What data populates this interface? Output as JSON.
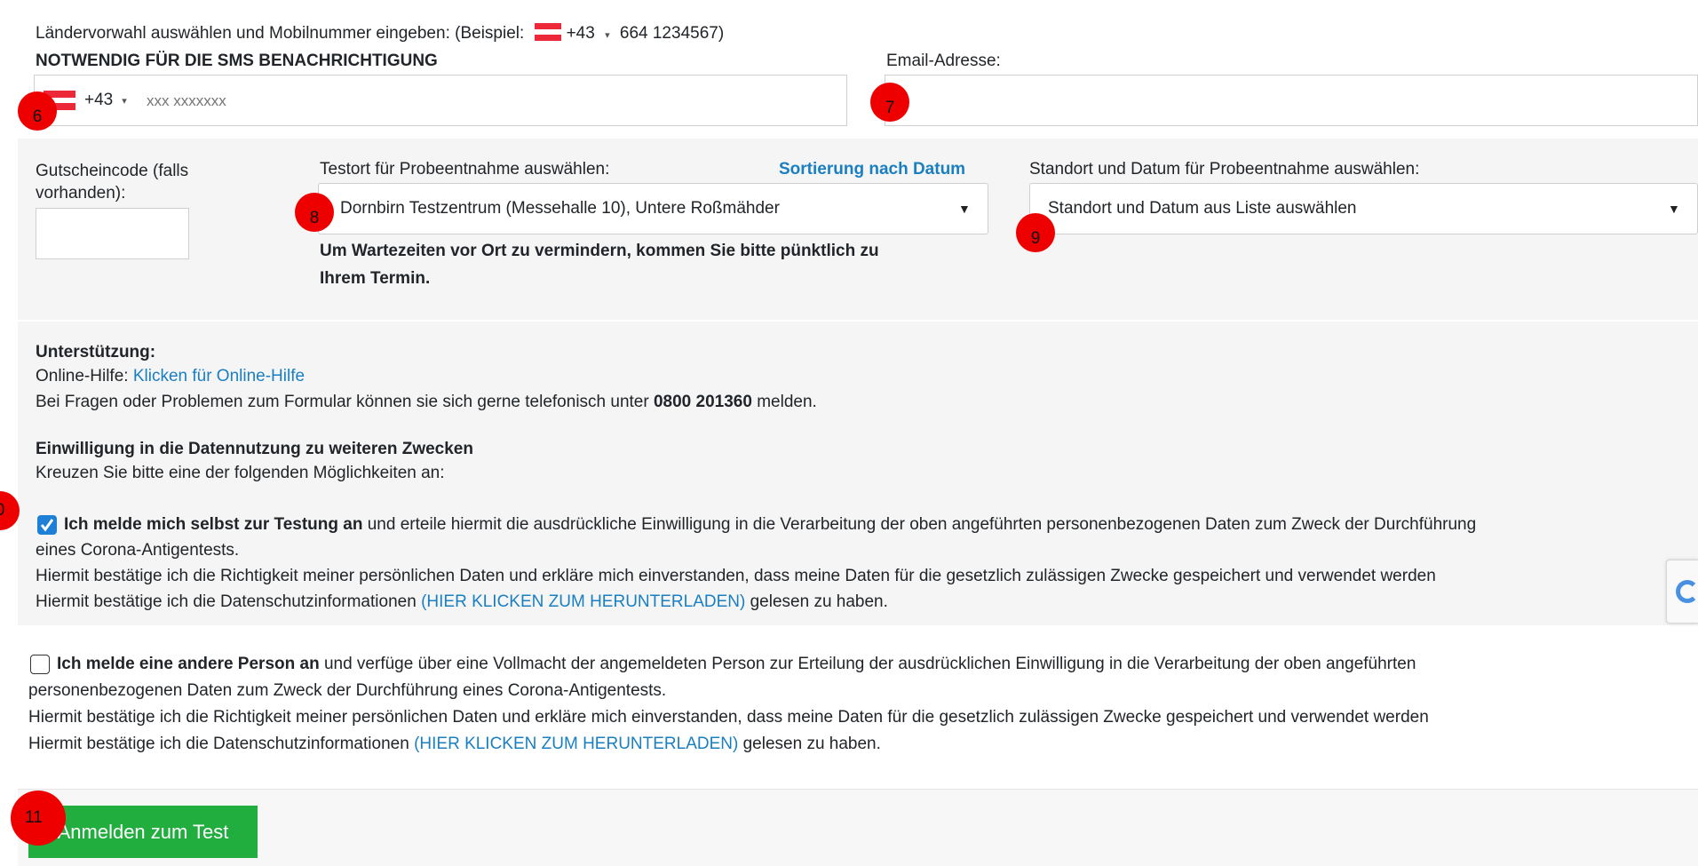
{
  "phone": {
    "instruction_prefix": "Ländervorwahl auswählen und Mobilnummer eingeben: (Beispiel:",
    "example_code": "+43",
    "example_caret": "▾",
    "example_number": "664 1234567)",
    "required_label": "NOTWENDIG FÜR DIE SMS BENACHRICHTIGUNG",
    "country_code": "+43",
    "caret": "▾",
    "placeholder": "xxx xxxxxxx",
    "marker": "6"
  },
  "email": {
    "label": "Email-Adresse:",
    "value": "",
    "marker": "7"
  },
  "voucher": {
    "label_line1": "Gutscheincode (falls",
    "label_line2": "vorhanden):",
    "value": ""
  },
  "test_location": {
    "label": "Testort für Probeentnahme auswählen:",
    "sort_link": "Sortierung nach Datum",
    "selected": "Dornbirn Testzentrum (Messehalle 10), Untere Roßmähder",
    "caret": "▼",
    "marker": "8",
    "notice_line1": "Um Wartezeiten vor Ort zu vermindern, kommen Sie bitte pünktlich zu",
    "notice_line2": "Ihrem Termin."
  },
  "site_date": {
    "label": "Standort und Datum für Probeentnahme auswählen:",
    "selected": "Standort und Datum aus Liste auswählen",
    "caret": "▼",
    "marker": "9"
  },
  "support": {
    "heading": "Unterstützung:",
    "online_help_prefix": "Online-Hilfe: ",
    "online_help_link": "Klicken für Online-Hilfe",
    "phone_prefix": "Bei Fragen oder Problemen zum Formular können sie sich gerne telefonisch unter ",
    "phone_number": "0800 201360",
    "phone_suffix": " melden."
  },
  "consent": {
    "heading": "Einwilligung in die Datennutzung zu weiteren Zwecken",
    "instruction": "Kreuzen Sie bitte eine der folgenden Möglichkeiten an:",
    "marker": "0",
    "self": {
      "checked": true,
      "bold": "Ich melde mich selbst zur Testung an",
      "text1": " und erteile hiermit die ausdrückliche Einwilligung in die Verarbeitung der oben angeführten personenbezogenen Daten zum Zweck der Durchführung",
      "text2": "eines Corona-Antigentests.",
      "text3": "Hiermit bestätige ich die Richtigkeit meiner persönlichen Daten und erkläre mich einverstanden, dass meine Daten für die gesetzlich zulässigen Zwecke gespeichert und verwendet werden",
      "text4_prefix": "Hiermit bestätige ich die Datenschutzinformationen ",
      "text4_link": "(HIER KLICKEN ZUM HERUNTERLADEN)",
      "text4_suffix": " gelesen zu haben."
    },
    "other": {
      "checked": false,
      "bold": "Ich melde eine andere Person an",
      "text1": " und verfüge über eine Vollmacht der angemeldeten Person zur Erteilung der ausdrücklichen Einwilligung in die Verarbeitung der oben angeführten",
      "text2": "personenbezogenen Daten zum Zweck der Durchführung eines Corona-Antigentests.",
      "text3": "Hiermit bestätige ich die Richtigkeit meiner persönlichen Daten und erkläre mich einverstanden, dass meine Daten für die gesetzlich zulässigen Zwecke gespeichert und verwendet werden",
      "text4_prefix": "Hiermit bestätige ich die Datenschutzinformationen ",
      "text4_link": "(HIER KLICKEN ZUM HERUNTERLADEN)",
      "text4_suffix": " gelesen zu haben."
    }
  },
  "submit": {
    "label": "Anmelden zum Test",
    "marker": "11"
  },
  "colors": {
    "link": "#1a7fc1",
    "button": "#22ad3f",
    "marker": "#ee0000",
    "checkbox": "#1e7fd7"
  }
}
